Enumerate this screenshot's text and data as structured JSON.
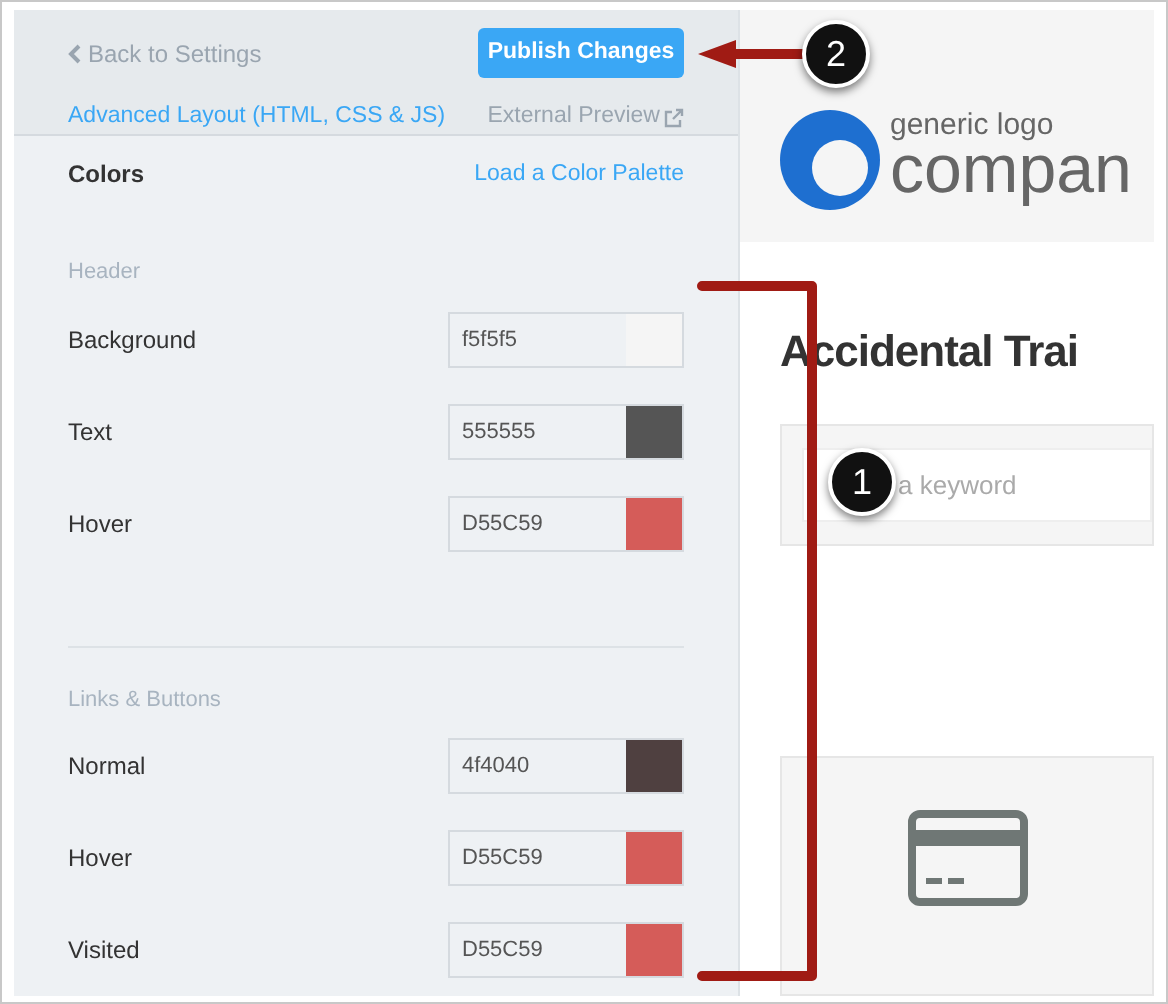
{
  "toolbar": {
    "back_link": "Back to Settings",
    "publish_button": "Publish Changes",
    "advanced_link": "Advanced Layout (HTML, CSS & JS)",
    "external_preview": "External Preview"
  },
  "colors": {
    "title": "Colors",
    "palette_link": "Load a Color Palette",
    "groups": [
      {
        "title": "Header",
        "rows": [
          {
            "label": "Background",
            "value": "f5f5f5",
            "color": "#f5f5f5"
          },
          {
            "label": "Text",
            "value": "555555",
            "color": "#555555"
          },
          {
            "label": "Hover",
            "value": "D55C59",
            "color": "#d55c59"
          }
        ]
      },
      {
        "title": "Links & Buttons",
        "rows": [
          {
            "label": "Normal",
            "value": "4f4040",
            "color": "#4f4040"
          },
          {
            "label": "Hover",
            "value": "D55C59",
            "color": "#d55c59"
          },
          {
            "label": "Visited",
            "value": "D55C59",
            "color": "#d55c59"
          }
        ]
      }
    ]
  },
  "preview": {
    "logo_top": "generic logo",
    "logo_bottom": "compan",
    "heading": "Accidental Trai",
    "search": {
      "placeholder": "a keyword"
    }
  },
  "callouts": [
    {
      "number": "1"
    },
    {
      "number": "2"
    }
  ]
}
